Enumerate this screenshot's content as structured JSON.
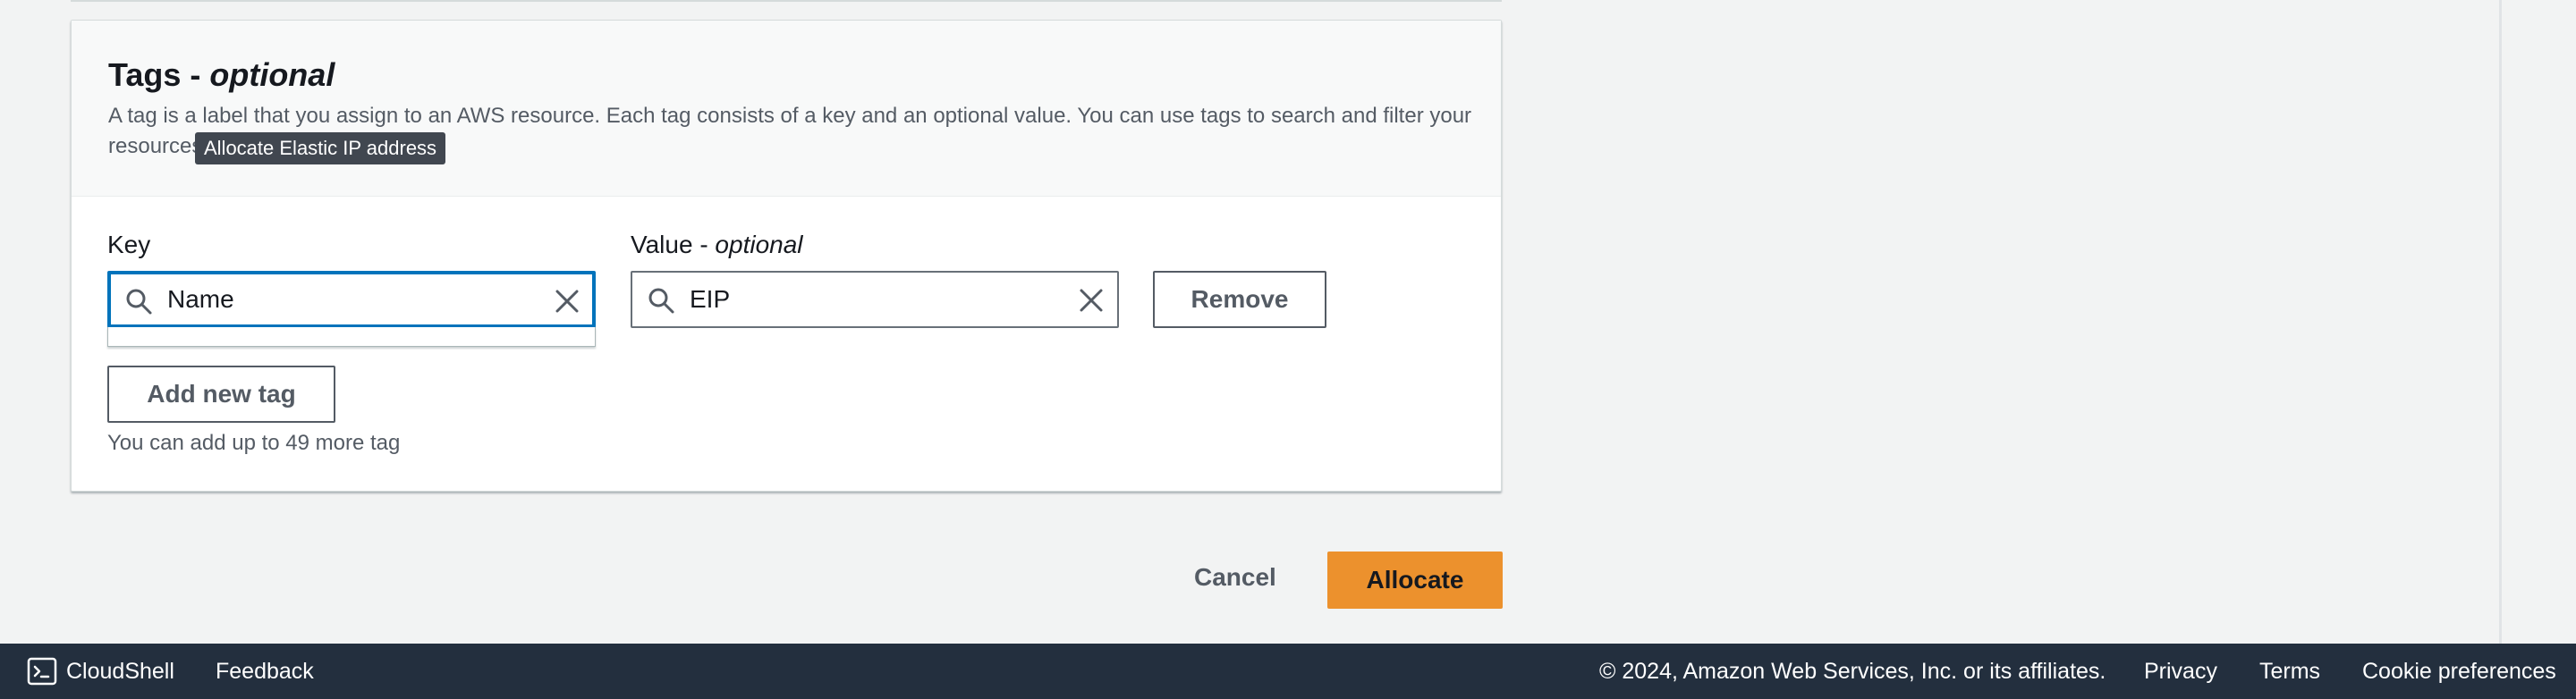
{
  "tags_section": {
    "title_main": "Tags - ",
    "title_optional": "optional",
    "description": "A tag is a label that you assign to an AWS resource. Each tag consists of a key and an optional value. You can use tags to search and filter your resources or track your AWS costs.",
    "tooltip": "Allocate Elastic IP address",
    "key_label": "Key",
    "value_label_main": "Value - ",
    "value_label_optional": "optional",
    "key_value": "Name",
    "value_value": "EIP",
    "remove_label": "Remove",
    "add_tag_label": "Add new tag",
    "hint": "You can add up to 49 more tag"
  },
  "actions": {
    "cancel_label": "Cancel",
    "allocate_label": "Allocate"
  },
  "footer": {
    "cloudshell_label": "CloudShell",
    "feedback_label": "Feedback",
    "copyright": "© 2024, Amazon Web Services, Inc. or its affiliates.",
    "privacy_label": "Privacy",
    "terms_label": "Terms",
    "cookies_label": "Cookie preferences"
  },
  "colors": {
    "primary_button": "#ec912d",
    "focus_border": "#0073bb",
    "footer_bg": "#232f3e",
    "page_bg": "#f2f3f3"
  },
  "icons": [
    "search-icon",
    "clear-icon",
    "cloudshell-icon"
  ]
}
